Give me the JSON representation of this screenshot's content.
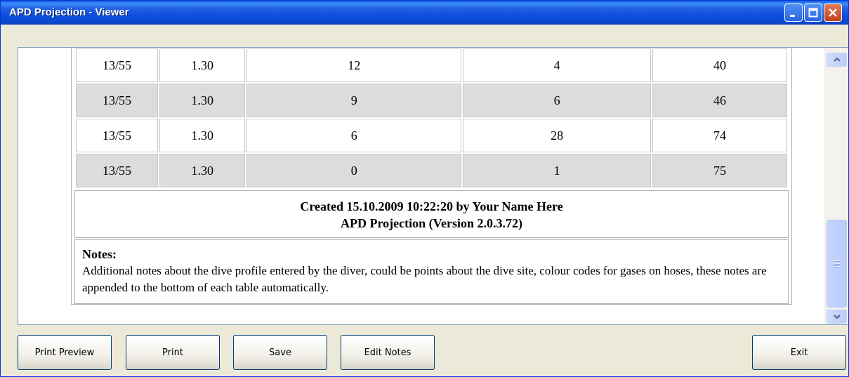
{
  "window": {
    "title": "APD Projection - Viewer"
  },
  "table": {
    "rows": [
      [
        "13/55",
        "1.30",
        "12",
        "4",
        "40"
      ],
      [
        "13/55",
        "1.30",
        "9",
        "6",
        "46"
      ],
      [
        "13/55",
        "1.30",
        "6",
        "28",
        "74"
      ],
      [
        "13/55",
        "1.30",
        "0",
        "1",
        "75"
      ]
    ]
  },
  "footer": {
    "created": "Created 15.10.2009 10:22:20 by Your Name Here",
    "version": "APD Projection (Version 2.0.3.72)"
  },
  "notes": {
    "title": "Notes:",
    "text": "Additional notes about the dive profile entered by the diver, could be points about the dive site, colour codes for gases on hoses, these notes are appended to the bottom of each table automatically."
  },
  "buttons": {
    "print_preview": "Print Preview",
    "print": "Print",
    "save": "Save",
    "edit_notes": "Edit Notes",
    "exit": "Exit"
  },
  "colors": {
    "titlebar": "#0b4fdf",
    "alt_row": "#dcdcdc",
    "window_bg": "#ece9d8"
  }
}
